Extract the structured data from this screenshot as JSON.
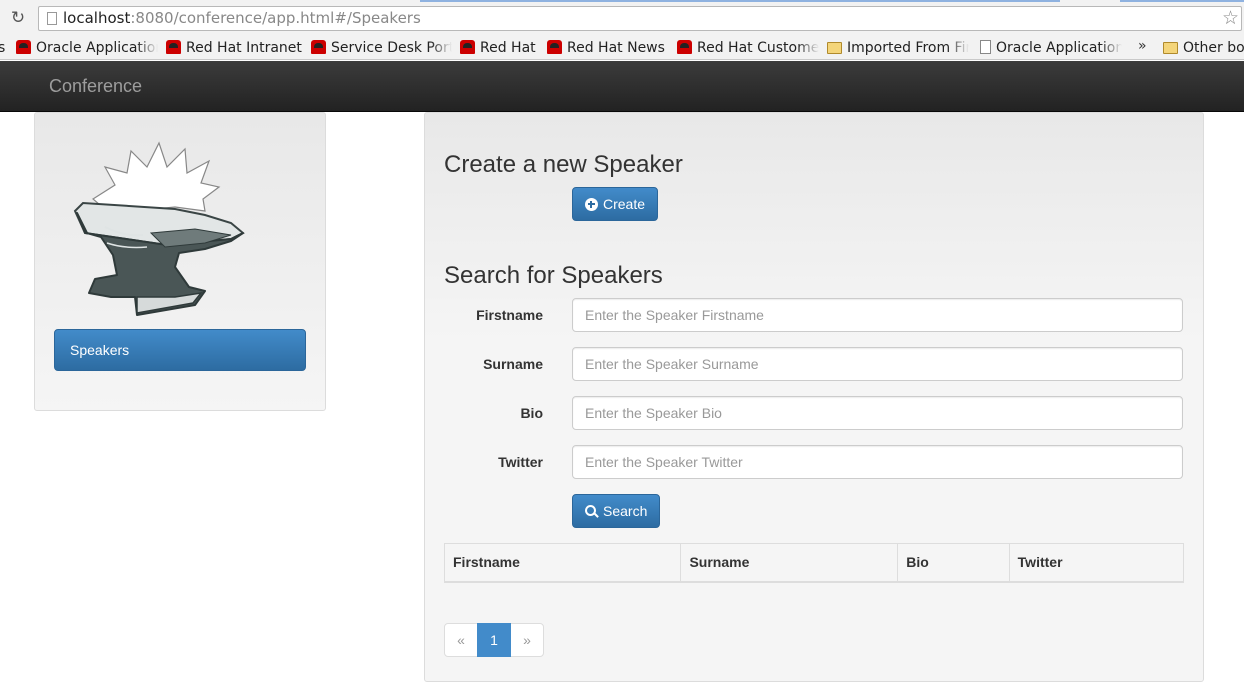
{
  "browser": {
    "url_host": "localhost",
    "url_rest": ":8080/conference/app.html#/Speakers",
    "bookmarks": [
      {
        "label": "s",
        "icon": "none"
      },
      {
        "label": "Oracle Applications",
        "icon": "redhat-icon"
      },
      {
        "label": "Red Hat Intranet",
        "icon": "redhat-icon"
      },
      {
        "label": "Service Desk Portal",
        "icon": "redhat-icon"
      },
      {
        "label": "Red Hat",
        "icon": "redhat-icon"
      },
      {
        "label": "Red Hat News",
        "icon": "redhat-icon"
      },
      {
        "label": "Red Hat Customer",
        "icon": "redhat-icon"
      },
      {
        "label": "Imported From Firefox",
        "icon": "folder-icon"
      },
      {
        "label": "Oracle Applications",
        "icon": "page-icon"
      }
    ],
    "overflow_label": "»",
    "other_bookmarks": "Other bookmarks"
  },
  "navbar": {
    "brand": "Conference"
  },
  "sidebar": {
    "items": [
      {
        "label": "Speakers"
      }
    ]
  },
  "create": {
    "heading": "Create a new Speaker",
    "button_label": "Create"
  },
  "search": {
    "heading": "Search for Speakers",
    "fields": [
      {
        "label": "Firstname",
        "placeholder": "Enter the Speaker Firstname",
        "value": ""
      },
      {
        "label": "Surname",
        "placeholder": "Enter the Speaker Surname",
        "value": ""
      },
      {
        "label": "Bio",
        "placeholder": "Enter the Speaker Bio",
        "value": ""
      },
      {
        "label": "Twitter",
        "placeholder": "Enter the Speaker Twitter",
        "value": ""
      }
    ],
    "button_label": "Search"
  },
  "results": {
    "columns": [
      "Firstname",
      "Surname",
      "Bio",
      "Twitter"
    ],
    "rows": []
  },
  "pagination": {
    "prev": "«",
    "current": "1",
    "next": "»"
  },
  "colors": {
    "primary": "#428bca",
    "navbar": "#222222",
    "panel": "#f5f5f5"
  }
}
